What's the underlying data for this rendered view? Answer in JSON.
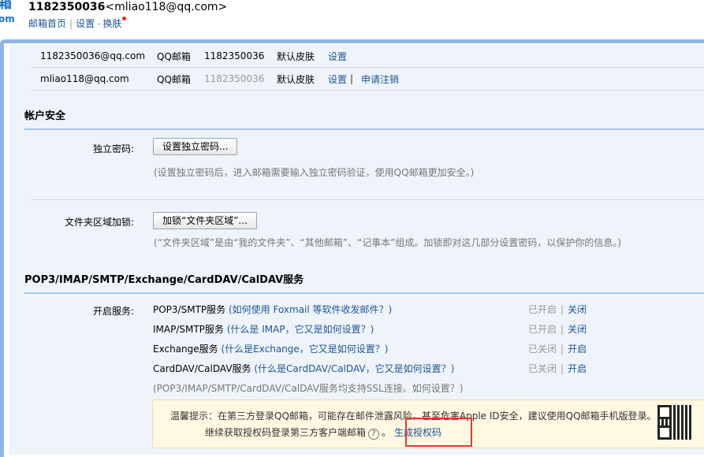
{
  "header": {
    "logo_top": "箱",
    "logo_bottom": "om",
    "account_id": "1182350036",
    "account_email": "<mliao118@qq.com>",
    "nav": [
      "邮箱首页",
      "设置",
      "换肤"
    ]
  },
  "accounts": [
    {
      "email": "1182350036@qq.com",
      "type": "QQ邮箱",
      "qq": "1182350036",
      "skin": "默认皮肤",
      "actions": [
        "设置"
      ]
    },
    {
      "email": "mliao118@qq.com",
      "type": "QQ邮箱",
      "qq": "1182350036",
      "skin": "默认皮肤",
      "actions": [
        "设置",
        "申请注销"
      ]
    }
  ],
  "security": {
    "title": "帐户安全",
    "pwd_label": "独立密码:",
    "pwd_button": "设置独立密码...",
    "pwd_hint": "(设置独立密码后，进入邮箱需要输入独立密码验证，使用QQ邮箱更加安全。)",
    "lock_label": "文件夹区域加锁:",
    "lock_button": "加锁“文件夹区域”...",
    "lock_hint": "(“文件夹区域”是由“我的文件夹”、“其他邮箱”、“记事本”组成。加锁即对这几部分设置密码，以保护你的信息。)"
  },
  "services": {
    "title": "POP3/IMAP/SMTP/Exchange/CardDAV/CalDAV服务",
    "label": "开启服务:",
    "items": [
      {
        "name": "POP3/SMTP服务",
        "help": "(如何使用 Foxmail 等软件收发邮件？)",
        "status": "已开启",
        "action": "关闭"
      },
      {
        "name": "IMAP/SMTP服务",
        "help": "(什么是 IMAP，它又是如何设置？)",
        "status": "已开启",
        "action": "关闭"
      },
      {
        "name": "Exchange服务",
        "help": "(什么是Exchange，它又是如何设置？)",
        "status": "已关闭",
        "action": "开启"
      },
      {
        "name": "CardDAV/CalDAV服务",
        "help": "(什么是CardDAV/CalDAV，它又是如何设置？)",
        "status": "已关闭",
        "action": "开启"
      }
    ],
    "ssl_note": "(POP3/IMAP/SMTP/CardDAV/CalDAV服务均支持SSL连接。如何设置？)",
    "tip_line1": "温馨提示：在第三方登录QQ邮箱，可能存在邮件泄露风险，甚至危害Apple ID安全，建议使用QQ邮箱手机版登录。",
    "tip_line2": "继续获取授权码登录第三方客户端邮箱",
    "tip_q": "?",
    "tip_period": "。",
    "generate_code": "生成授权码"
  }
}
